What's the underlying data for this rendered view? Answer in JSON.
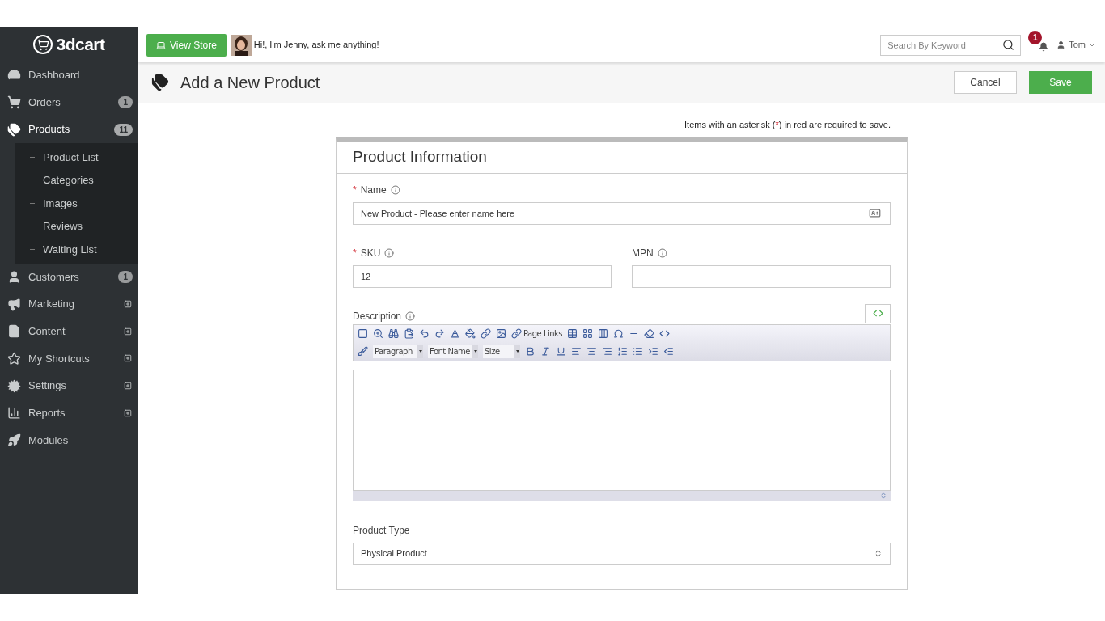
{
  "logo": "3dcart",
  "topbar": {
    "view_store": "View Store",
    "assistant": "Hi!, I'm Jenny, ask me anything!",
    "search": {
      "placeholder": "Search By Keyword"
    },
    "notifications": "1",
    "user": "Tom"
  },
  "sidebar": {
    "items": [
      {
        "label": "Dashboard",
        "selected": false
      },
      {
        "label": "Orders",
        "badge": "1",
        "selected": false
      },
      {
        "label": "Products",
        "badge": "11",
        "selected": true,
        "expanded": true,
        "children": [
          {
            "label": "Product List"
          },
          {
            "label": "Categories"
          },
          {
            "label": "Images"
          },
          {
            "label": "Reviews"
          },
          {
            "label": "Waiting List"
          }
        ]
      },
      {
        "label": "Customers",
        "badge": "1",
        "selected": false
      },
      {
        "label": "Marketing",
        "expandable": true,
        "selected": false
      },
      {
        "label": "Content",
        "expandable": true,
        "selected": false
      },
      {
        "label": "My Shortcuts",
        "expandable": true,
        "selected": false
      },
      {
        "label": "Settings",
        "expandable": true,
        "selected": false
      },
      {
        "label": "Reports",
        "expandable": true,
        "selected": false
      },
      {
        "label": "Modules",
        "selected": false
      }
    ]
  },
  "page": {
    "title": "Add a New Product",
    "cancel": "Cancel",
    "save": "Save"
  },
  "notice": {
    "before": "Items with an asterisk (",
    "mark": "*",
    "after": ") in red are required to save."
  },
  "form": {
    "title": "Product Information",
    "name": {
      "label": "Name",
      "required": true,
      "value": "New Product - Please enter name here"
    },
    "sku": {
      "label": "SKU",
      "required": true,
      "value": "12"
    },
    "mpn": {
      "label": "MPN",
      "required": false
    },
    "description": {
      "label": "Description",
      "required": false,
      "page_links": "Page Links",
      "paragraph": "Paragraph",
      "font_name": "Font Name",
      "size": "Size"
    },
    "product_type": {
      "label": "Product Type",
      "value": "Physical Product"
    }
  }
}
